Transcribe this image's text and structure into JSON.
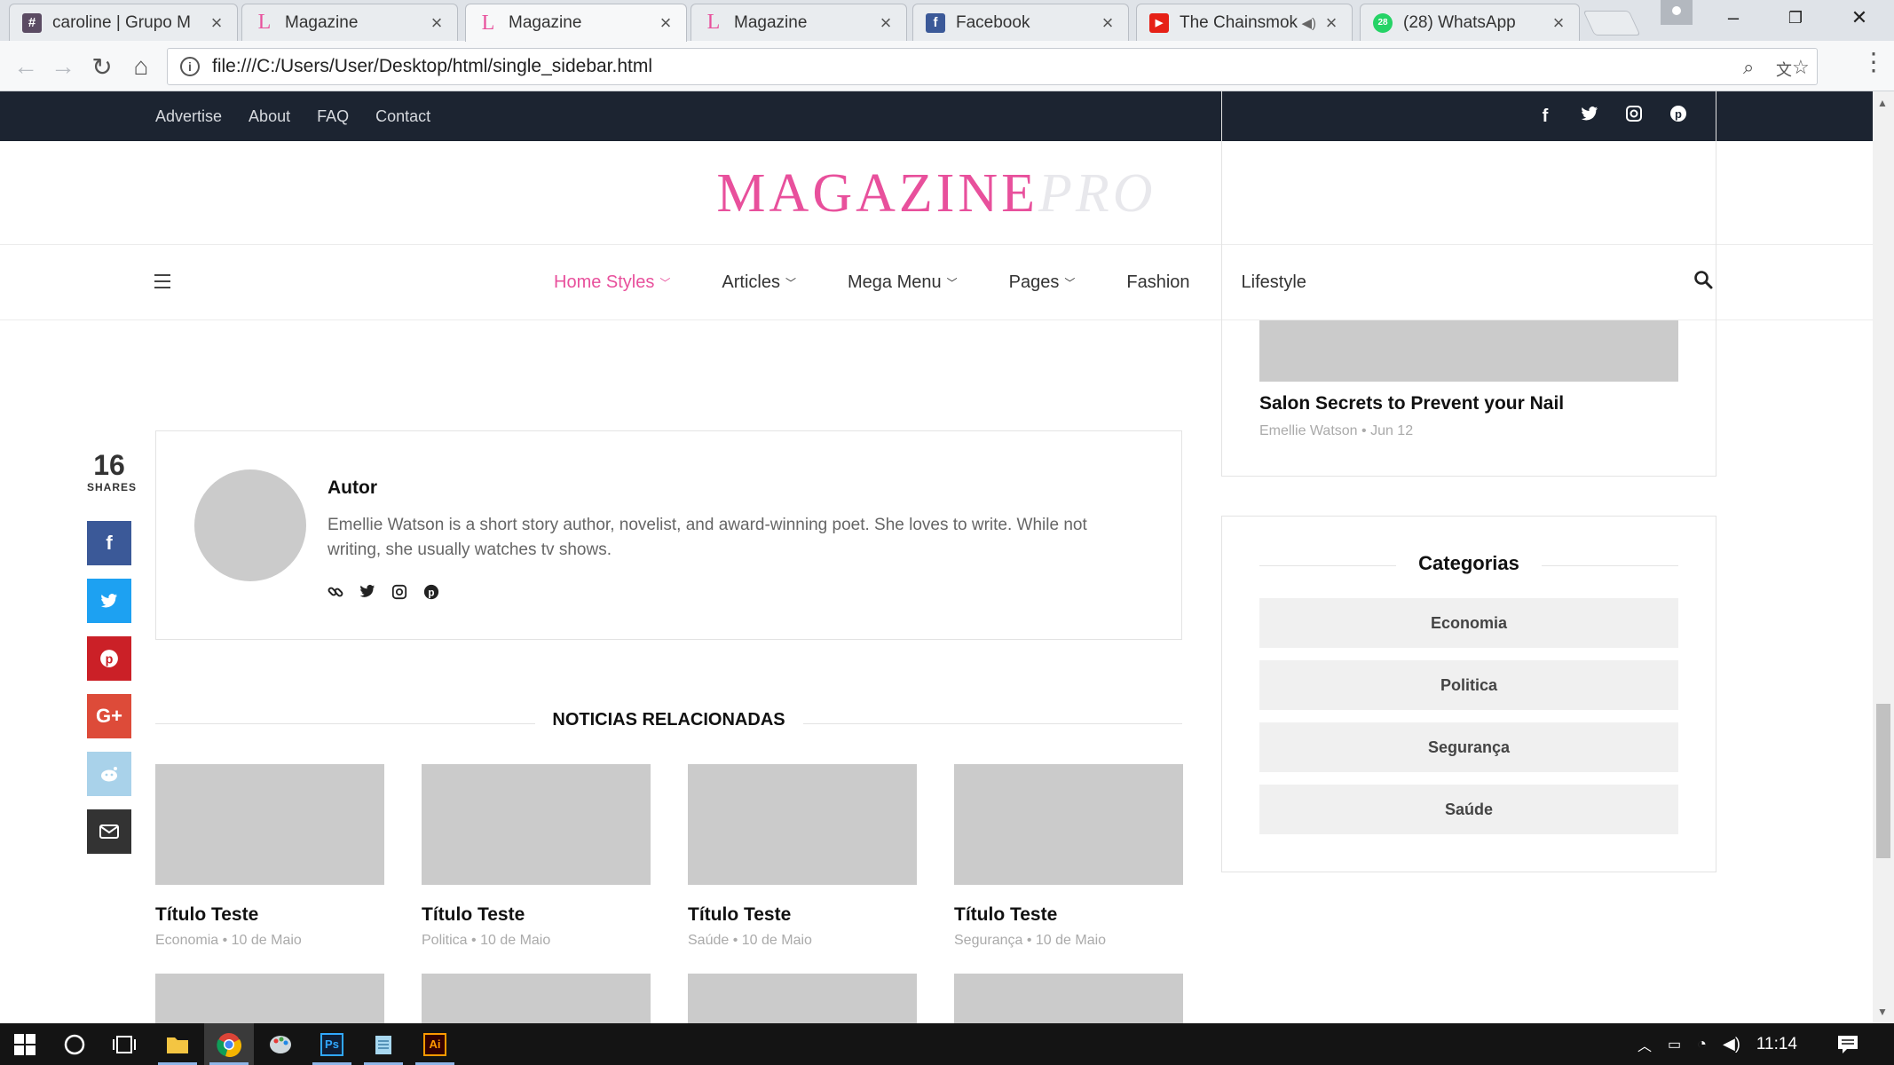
{
  "browser": {
    "tabs": [
      {
        "title": "caroline | Grupo M",
        "favicon": "#",
        "fav_color": "#5b4b63"
      },
      {
        "title": "Magazine",
        "favicon": "L",
        "fav_color": "#e8509c"
      },
      {
        "title": "Magazine",
        "favicon": "L",
        "fav_color": "#e8509c"
      },
      {
        "title": "Magazine",
        "favicon": "L",
        "fav_color": "#e8509c"
      },
      {
        "title": "Facebook",
        "favicon": "f",
        "fav_color": "#3b5998"
      },
      {
        "title": "The Chainsmok",
        "favicon": "▶",
        "fav_color": "#e62117"
      },
      {
        "title": "(28) WhatsApp",
        "favicon": "28",
        "fav_color": "#25d366"
      }
    ],
    "address": "file:///C:/Users/User/Desktop/html/single_sidebar.html"
  },
  "topbar": {
    "links": [
      "Advertise",
      "About",
      "FAQ",
      "Contact"
    ],
    "social_icons": [
      "facebook-icon",
      "twitter-icon",
      "instagram-icon",
      "pinterest-icon"
    ]
  },
  "logo": {
    "main": "MAGAZINE",
    "accent": "PRO"
  },
  "nav": {
    "items": [
      {
        "label": "Home Styles",
        "dropdown": true
      },
      {
        "label": "Articles",
        "dropdown": true
      },
      {
        "label": "Mega Menu",
        "dropdown": true
      },
      {
        "label": "Pages",
        "dropdown": true
      },
      {
        "label": "Fashion",
        "dropdown": false
      },
      {
        "label": "Lifestyle",
        "dropdown": false
      }
    ]
  },
  "share": {
    "count": "16",
    "label": "SHARES",
    "buttons": [
      {
        "icon": "facebook-icon",
        "glyph": "f",
        "color": "#3b5998"
      },
      {
        "icon": "twitter-icon",
        "glyph": "t",
        "color": "#1da1f2"
      },
      {
        "icon": "pinterest-icon",
        "glyph": "p",
        "color": "#cb2027"
      },
      {
        "icon": "google-plus-icon",
        "glyph": "G+",
        "color": "#dd4b39"
      },
      {
        "icon": "reddit-icon",
        "glyph": "r",
        "color": "#a9d2ea"
      },
      {
        "icon": "email-icon",
        "glyph": "✉",
        "color": "#333333"
      }
    ]
  },
  "author": {
    "name": "Autor",
    "bio": "Emellie Watson is a short story author, novelist, and award-winning poet. She loves to write. While not writing, she usually watches tv shows.",
    "icons": [
      "link-icon",
      "twitter-icon",
      "instagram-icon",
      "pinterest-icon"
    ]
  },
  "related": {
    "title": "NOTICIAS RELACIONADAS",
    "cards": [
      {
        "title": "Título Teste",
        "category": "Economia",
        "date": "10 de Maio"
      },
      {
        "title": "Título Teste",
        "category": "Politica",
        "date": "10 de Maio"
      },
      {
        "title": "Título Teste",
        "category": "Saúde",
        "date": "10 de Maio"
      },
      {
        "title": "Título Teste",
        "category": "Segurança",
        "date": "10 de Maio"
      }
    ]
  },
  "sidebar": {
    "post": {
      "title": "Salon Secrets to Prevent your Nail",
      "author": "Emellie Watson",
      "date": "Jun 12"
    },
    "categories_title": "Categorias",
    "categories": [
      "Economia",
      "Politica",
      "Segurança",
      "Saúde"
    ]
  },
  "taskbar": {
    "time": "11:14"
  },
  "colors": {
    "accent": "#e8509c",
    "topbar": "#1c2431"
  }
}
